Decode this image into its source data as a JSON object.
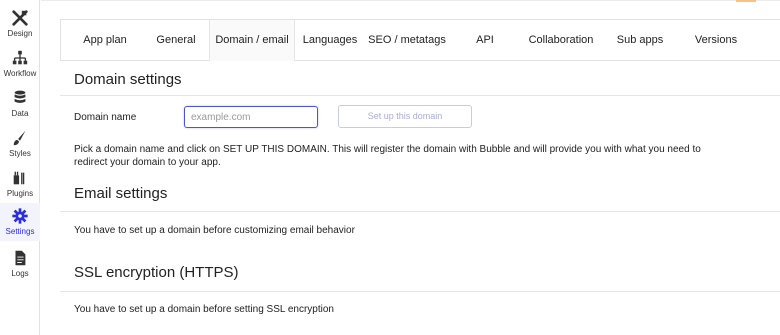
{
  "sidebar": {
    "items": [
      {
        "label": "Design",
        "icon": "design-icon"
      },
      {
        "label": "Workflow",
        "icon": "workflow-icon"
      },
      {
        "label": "Data",
        "icon": "data-icon"
      },
      {
        "label": "Styles",
        "icon": "styles-icon"
      },
      {
        "label": "Plugins",
        "icon": "plugins-icon"
      },
      {
        "label": "Settings",
        "icon": "gear-icon",
        "active": true
      },
      {
        "label": "Logs",
        "icon": "logs-icon"
      }
    ]
  },
  "tabs": [
    {
      "label": "App plan"
    },
    {
      "label": "General"
    },
    {
      "label": "Domain / email",
      "active": true
    },
    {
      "label": "Languages"
    },
    {
      "label": "SEO / metatags"
    },
    {
      "label": "API"
    },
    {
      "label": "Collaboration"
    },
    {
      "label": "Sub apps"
    },
    {
      "label": "Versions"
    }
  ],
  "domain_settings": {
    "title": "Domain settings",
    "domain_label": "Domain name",
    "domain_placeholder": "example.com",
    "setup_button": "Set up this domain",
    "description": "Pick a domain name and click on SET UP THIS DOMAIN. This will register the domain with Bubble and will provide you with what you need to redirect your domain to your app."
  },
  "email_settings": {
    "title": "Email settings",
    "message": "You have to set up a domain before customizing email behavior"
  },
  "ssl": {
    "title": "SSL encryption (HTTPS)",
    "message": "You have to set up a domain before setting SSL encryption"
  },
  "colors": {
    "accent": "#2b2ee0",
    "input_border": "#4b56c8"
  }
}
